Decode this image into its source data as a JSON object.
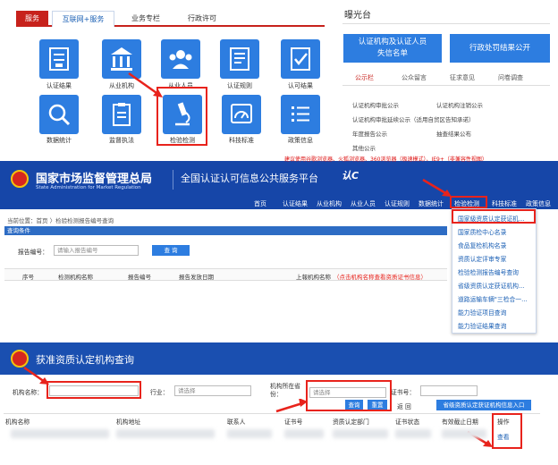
{
  "top_panel": {
    "tabs": [
      "服务",
      "互联网+服务",
      "业务专栏",
      "行政许可"
    ],
    "icons": [
      {
        "label": "认证结果",
        "icon": "certificate-icon"
      },
      {
        "label": "从业机构",
        "icon": "building-icon"
      },
      {
        "label": "从业人员",
        "icon": "people-icon"
      },
      {
        "label": "认证规则",
        "icon": "rules-doc-icon"
      },
      {
        "label": "认可结果",
        "icon": "approved-icon"
      },
      {
        "label": "数据统计",
        "icon": "stats-search-icon"
      },
      {
        "label": "监督执法",
        "icon": "clipboard-icon"
      },
      {
        "label": "检验检测",
        "icon": "microscope-icon"
      },
      {
        "label": "科技标准",
        "icon": "gauge-icon"
      },
      {
        "label": "政策信息",
        "icon": "list-icon"
      }
    ],
    "side": {
      "title": "曝光台",
      "btn_left": "认证机构及认证人员\n失信名单",
      "btn_right": "行政处罚结果公开",
      "subtabs": [
        "公示栏",
        "公众留言",
        "征求意见",
        "问卷调查"
      ],
      "items": [
        "认证机构审批公示",
        "认证机构注销公示",
        "认证机构审批延续公示（适用自贸区告知承诺）",
        "年度报告公示",
        "抽查结果公布",
        "其他公示"
      ]
    }
  },
  "header": {
    "title": "国家市场监督管理总局",
    "subtitle": "State Administration for Market Regulation",
    "platform": "全国认证认可信息公共服务平台",
    "warning": "建议使用谷歌浏览器、火狐浏览器、360浏览器（极速模式）、IE9+（非兼容性视图）",
    "nav": [
      "首页",
      "认证结果",
      "从业机构",
      "从业人员",
      "认证规则",
      "数据统计",
      "检验检测",
      "科技标准",
      "政策信息"
    ]
  },
  "middle": {
    "breadcrumb": "当前位置：首页 〉检验检测报告编号查询",
    "bar": "查询条件",
    "report_label": "报告编号：",
    "report_placeholder": "请输入报告编号",
    "query_btn": "查 询",
    "columns": [
      "序号",
      "检测机构名称",
      "报告编号",
      "报告发放日期",
      "上報机构名称"
    ],
    "columns_note": "（点击机构名称查看资质证书信息）",
    "dropdown": [
      "国家級资质认定获证机...",
      "国家质检中心名录",
      "食品复检机构名录",
      "资质认定评审专家",
      "检验检测报告编号查询",
      "省级资质认定获证机构...",
      "道路运输车辆\"三检合一...",
      "能力验证项目查询",
      "能力验证结果查询"
    ]
  },
  "bottom": {
    "title": "获准资质认定机构查询",
    "org_label": "机构名称：",
    "industry_label": "行业：",
    "industry_value": "请选择",
    "region_label": "机构所在省份：",
    "region_value": "请选择",
    "cert_label": "证书号：",
    "btn_query": "查询",
    "btn_reset": "重置",
    "btn_back": "返 回",
    "btn_export": "省级资质认定获证机构信息入口",
    "columns": [
      "机构名称",
      "机构地址",
      "联系人",
      "证书号",
      "资质认定部门",
      "证书状态",
      "有效截止日期",
      "操作"
    ],
    "view": "查看"
  }
}
